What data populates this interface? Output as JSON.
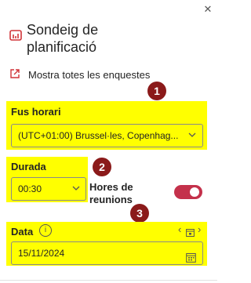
{
  "panel": {
    "close_glyph": "✕",
    "title": "Sondeig de planificació",
    "show_all_label": "Mostra totes les enquestes"
  },
  "badges": [
    "1",
    "2",
    "3"
  ],
  "timezone": {
    "label": "Fus horari",
    "value": "(UTC+01:00) Brussel·les, Copenhag..."
  },
  "duration": {
    "label": "Durada",
    "value": "00:30"
  },
  "meeting_hours": {
    "label_line1": "Hores de",
    "label_line2": "reunions",
    "enabled": true
  },
  "date": {
    "label": "Data",
    "info_glyph": "i",
    "value": "15/11/2024",
    "prev_glyph": "‹",
    "next_glyph": "›"
  },
  "colors": {
    "highlight": "#ffff00",
    "badge": "#8b1a1a",
    "toggle_on": "#c4314b",
    "icon_accent": "#d13438"
  }
}
